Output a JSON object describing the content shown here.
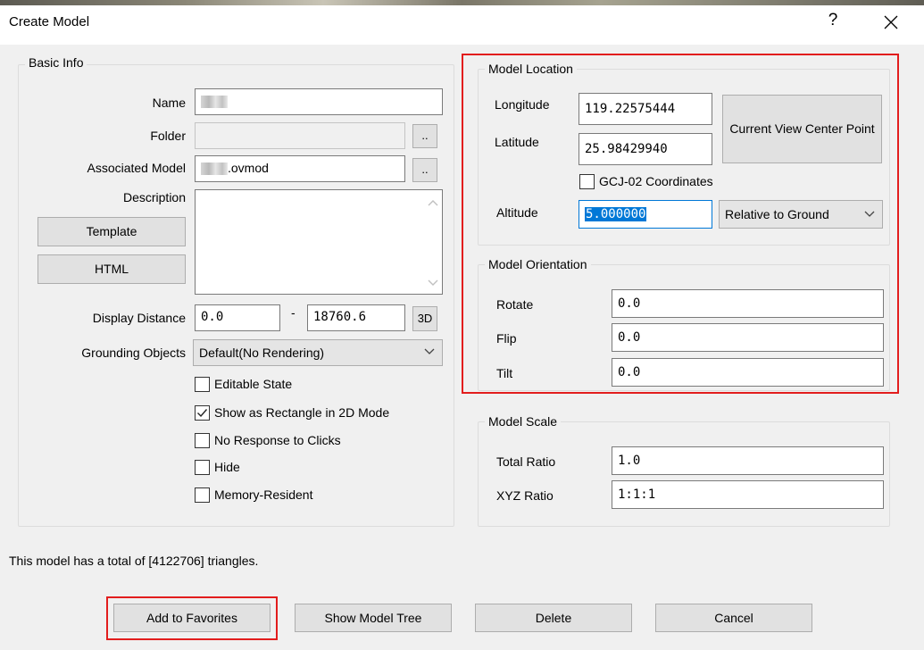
{
  "window": {
    "title": "Create Model",
    "help_label": "?"
  },
  "basic_info": {
    "legend": "Basic Info",
    "name_label": "Name",
    "name_value": "",
    "folder_label": "Folder",
    "folder_value": "",
    "browse_label": "..",
    "associated_model_label": "Associated Model",
    "associated_model_value": ".ovmod",
    "description_label": "Description",
    "template_label": "Template",
    "html_label": "HTML",
    "display_distance_label": "Display Distance",
    "display_distance_min": "0.0",
    "display_distance_sep": "-",
    "display_distance_max": "18760.6",
    "btn_3d_label": "3D",
    "grounding_label": "Grounding Objects",
    "grounding_value": "Default(No Rendering)",
    "checkboxes": [
      {
        "label": "Editable State",
        "checked": false
      },
      {
        "label": "Show as Rectangle in 2D Mode",
        "checked": true
      },
      {
        "label": "No Response to Clicks",
        "checked": false
      },
      {
        "label": "Hide",
        "checked": false
      },
      {
        "label": "Memory-Resident",
        "checked": false
      }
    ]
  },
  "model_location": {
    "legend": "Model Location",
    "longitude_label": "Longitude",
    "longitude_value": "119.22575444",
    "latitude_label": "Latitude",
    "latitude_value": "25.98429940",
    "current_view_label": "Current View Center Point",
    "gcj_label": "GCJ-02 Coordinates",
    "gcj_checked": false,
    "altitude_label": "Altitude",
    "altitude_value": "5.000000",
    "altitude_mode": "Relative to Ground"
  },
  "model_orientation": {
    "legend": "Model Orientation",
    "rotate_label": "Rotate",
    "rotate_value": "0.0",
    "flip_label": "Flip",
    "flip_value": "0.0",
    "tilt_label": "Tilt",
    "tilt_value": "0.0"
  },
  "model_scale": {
    "legend": "Model Scale",
    "total_ratio_label": "Total Ratio",
    "total_ratio_value": "1.0",
    "xyz_ratio_label": "XYZ Ratio",
    "xyz_ratio_value": "1:1:1"
  },
  "status": {
    "triangles_text": "This model has a total of [4122706] triangles."
  },
  "footer": {
    "add_favorites_label": "Add to Favorites",
    "show_tree_label": "Show Model Tree",
    "delete_label": "Delete",
    "cancel_label": "Cancel"
  },
  "colors": {
    "highlight": "#e21d1d",
    "selection": "#0078d7"
  }
}
